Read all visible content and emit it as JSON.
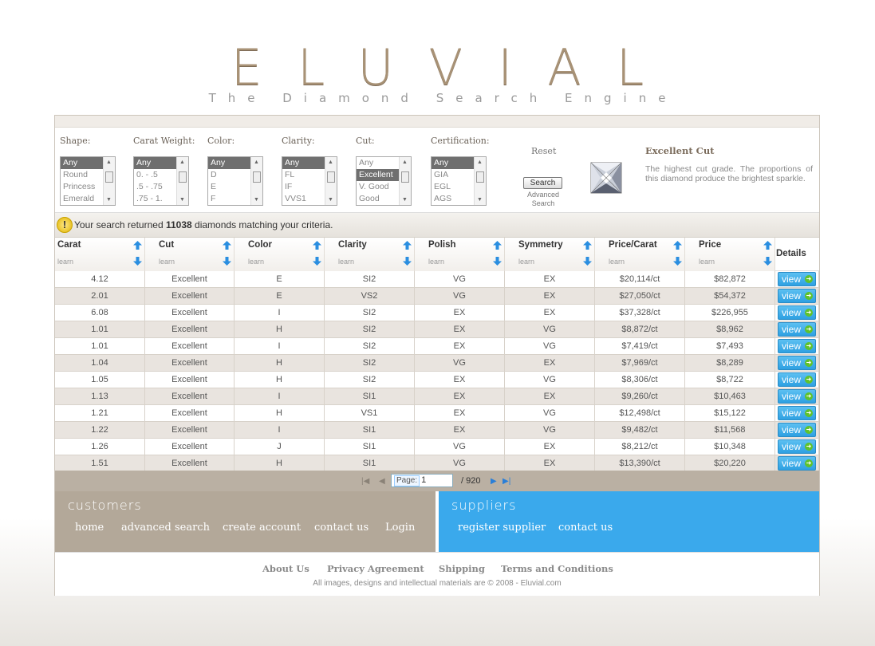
{
  "header": {
    "logo": "ELUVIAL",
    "tagline": "The Diamond Search Engine"
  },
  "filters": {
    "shape": {
      "label": "Shape:",
      "options": [
        "Any",
        "Round",
        "Princess",
        "Emerald"
      ],
      "selected": "Any"
    },
    "carat": {
      "label": "Carat Weight:",
      "options": [
        "Any",
        "0. - .5",
        ".5 - .75",
        ".75 - 1."
      ],
      "selected": "Any"
    },
    "color": {
      "label": "Color:",
      "options": [
        "Any",
        "D",
        "E",
        "F"
      ],
      "selected": "Any"
    },
    "clarity": {
      "label": "Clarity:",
      "options": [
        "Any",
        "FL",
        "IF",
        "VVS1"
      ],
      "selected": "Any"
    },
    "cut": {
      "label": "Cut:",
      "options": [
        "Any",
        "Excellent",
        "V. Good",
        "Good"
      ],
      "selected": "Excellent"
    },
    "certification": {
      "label": "Certification:",
      "options": [
        "Any",
        "GIA",
        "EGL",
        "AGS"
      ],
      "selected": "Any"
    },
    "reset_label": "Reset",
    "search_label": "Search",
    "advanced_label": "Advanced Search"
  },
  "cut_info": {
    "title": "Excellent Cut",
    "description": "The highest cut grade. The proportions of this diamond produce the brightest sparkle."
  },
  "results": {
    "prefix": "Your search returned",
    "count": "11038",
    "suffix": "diamonds matching your criteria."
  },
  "table": {
    "columns": [
      "Carat",
      "Cut",
      "Color",
      "Clarity",
      "Polish",
      "Symmetry",
      "Price/Carat",
      "Price"
    ],
    "learn_label": "learn",
    "details_label": "Details",
    "view_label": "view",
    "rows": [
      [
        "4.12",
        "Excellent",
        "E",
        "SI2",
        "VG",
        "EX",
        "$20,114/ct",
        "$82,872"
      ],
      [
        "2.01",
        "Excellent",
        "E",
        "VS2",
        "VG",
        "EX",
        "$27,050/ct",
        "$54,372"
      ],
      [
        "6.08",
        "Excellent",
        "I",
        "SI2",
        "EX",
        "EX",
        "$37,328/ct",
        "$226,955"
      ],
      [
        "1.01",
        "Excellent",
        "H",
        "SI2",
        "EX",
        "VG",
        "$8,872/ct",
        "$8,962"
      ],
      [
        "1.01",
        "Excellent",
        "I",
        "SI2",
        "EX",
        "VG",
        "$7,419/ct",
        "$7,493"
      ],
      [
        "1.04",
        "Excellent",
        "H",
        "SI2",
        "VG",
        "EX",
        "$7,969/ct",
        "$8,289"
      ],
      [
        "1.05",
        "Excellent",
        "H",
        "SI2",
        "EX",
        "VG",
        "$8,306/ct",
        "$8,722"
      ],
      [
        "1.13",
        "Excellent",
        "I",
        "SI1",
        "EX",
        "EX",
        "$9,260/ct",
        "$10,463"
      ],
      [
        "1.21",
        "Excellent",
        "H",
        "VS1",
        "EX",
        "VG",
        "$12,498/ct",
        "$15,122"
      ],
      [
        "1.22",
        "Excellent",
        "I",
        "SI1",
        "EX",
        "VG",
        "$9,482/ct",
        "$11,568"
      ],
      [
        "1.26",
        "Excellent",
        "J",
        "SI1",
        "VG",
        "EX",
        "$8,212/ct",
        "$10,348"
      ],
      [
        "1.51",
        "Excellent",
        "H",
        "SI1",
        "VG",
        "EX",
        "$13,390/ct",
        "$20,220"
      ]
    ]
  },
  "pager": {
    "page_label": "Page:",
    "page_value": "1",
    "total": "/ 920"
  },
  "customers": {
    "title": "customers",
    "links": [
      "home",
      "advanced search",
      "create account",
      "contact us",
      "Login"
    ]
  },
  "suppliers": {
    "title": "suppliers",
    "links": [
      "register supplier",
      "contact us"
    ]
  },
  "footer": {
    "links": [
      "About Us",
      "Privacy Agreement",
      "Shipping",
      "Terms and Conditions"
    ],
    "copyright": "All images, designs and intellectual materials are © 2008 - Eluvial.com"
  },
  "colors": {
    "brand": "#a89276",
    "suppliers_bg": "#3aa9ec",
    "customers_bg": "#b3a899",
    "view_button": "#3aa5e8"
  }
}
